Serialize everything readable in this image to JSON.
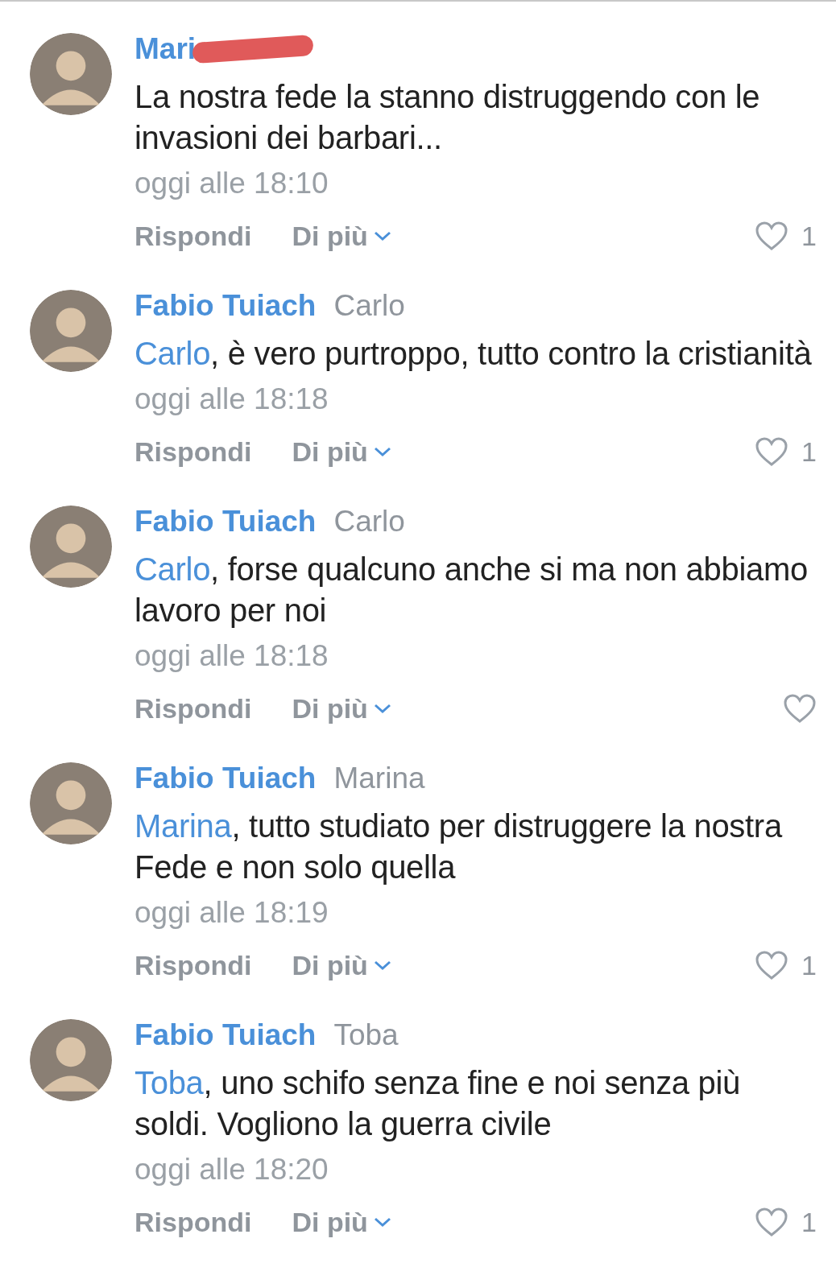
{
  "comments": [
    {
      "author": "Mari",
      "redacted": true,
      "text": "La nostra fede la stanno distruggendo con le invasioni dei barbari...",
      "time": "oggi alle 18:10",
      "actions": [
        "Rispondi",
        "Di più"
      ],
      "likes": "1"
    },
    {
      "author": "Fabio Tuiach",
      "reply_to": "Carlo",
      "mention": "Carlo",
      "text": ", è vero purtroppo, tutto contro la cristianità",
      "time": "oggi alle 18:18",
      "actions": [
        "Rispondi",
        "Di più"
      ],
      "likes": "1"
    },
    {
      "author": "Fabio Tuiach",
      "reply_to": "Carlo",
      "mention": "Carlo",
      "text": ", forse qualcuno anche si ma non abbiamo lavoro per noi",
      "time": "oggi alle 18:18",
      "actions": [
        "Rispondi",
        "Di più"
      ]
    },
    {
      "author": "Fabio Tuiach",
      "reply_to": "Marina",
      "mention": "Marina",
      "text": ", tutto studiato per distruggere la nostra Fede e non solo quella",
      "time": "oggi alle 18:19",
      "actions": [
        "Rispondi",
        "Di più"
      ],
      "likes": "1"
    },
    {
      "author": "Fabio Tuiach",
      "reply_to": "Toba",
      "mention": "Toba",
      "text": ", uno schifo senza fine e noi senza più soldi. Vogliono la guerra civile",
      "time": "oggi alle 18:20",
      "actions": [
        "Rispondi",
        "Di più"
      ],
      "likes": "1"
    }
  ]
}
